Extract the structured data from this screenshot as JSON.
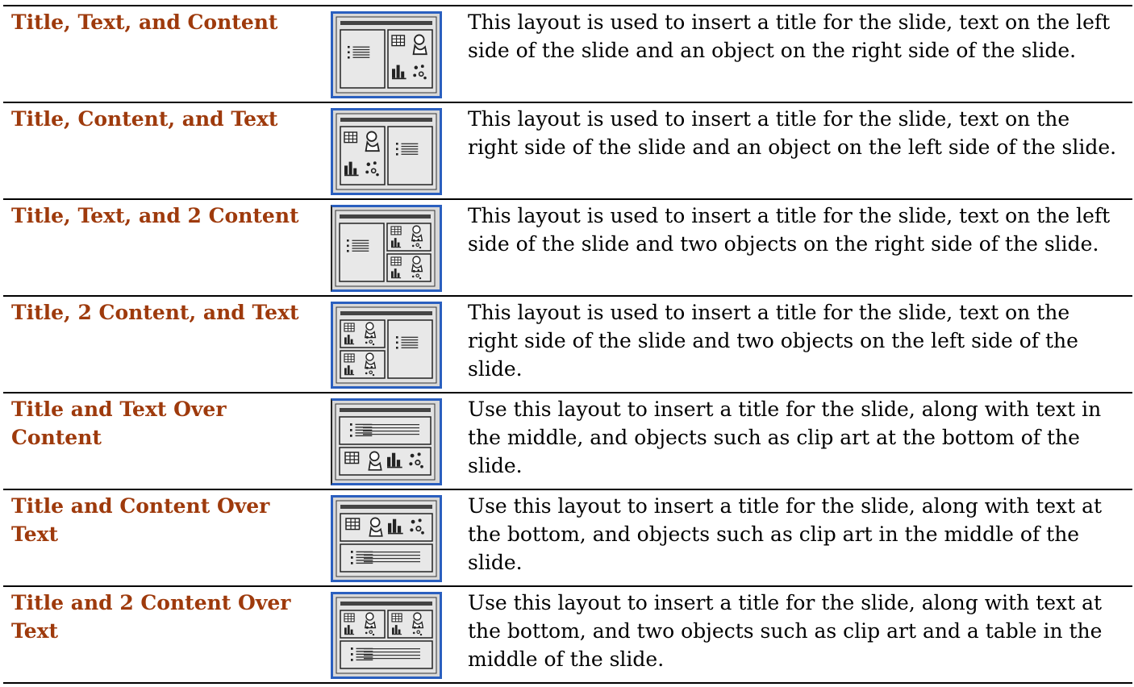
{
  "rows": [
    {
      "name": "Title, Text, and Content",
      "description": "This layout is used to insert a title for the slide, text on the left side of the slide and an object on the right side of the slide.",
      "icon": "layout-title-text-content-icon"
    },
    {
      "name": "Title, Content, and Text",
      "description": "This layout is used to insert a title for the slide, text on the right side of the slide and an object on the left side of the slide.",
      "icon": "layout-title-content-text-icon"
    },
    {
      "name": "Title, Text, and 2 Content",
      "description": "This layout is used to insert a title for the slide, text on the left side of the slide and two objects on the right side of the slide.",
      "icon": "layout-title-text-2content-icon"
    },
    {
      "name": "Title, 2 Content, and Text",
      "description": "This layout is used to insert a title for the slide, text on the right side of the slide and two objects on the left side of the slide.",
      "icon": "layout-title-2content-text-icon"
    },
    {
      "name": "Title and Text Over Content",
      "description": "Use this layout to insert a title for the slide, along with text in the middle, and objects such as clip art at the bottom of the slide.",
      "icon": "layout-title-text-over-content-icon"
    },
    {
      "name": "Title and Content Over Text",
      "description": "Use this layout to insert a title for the slide, along with text at the bottom, and objects such as clip art in the middle of the slide.",
      "icon": "layout-title-content-over-text-icon"
    },
    {
      "name": "Title and 2 Content Over Text",
      "description": "Use this layout to insert a title for the slide, along with text at the bottom, and two objects such as clip art and a table in the middle of the slide.",
      "icon": "layout-title-2content-over-text-icon"
    }
  ],
  "colors": {
    "name_text": "#9e3a0c",
    "icon_border": "#2a5fbf",
    "icon_background": "#d8d8d8"
  }
}
